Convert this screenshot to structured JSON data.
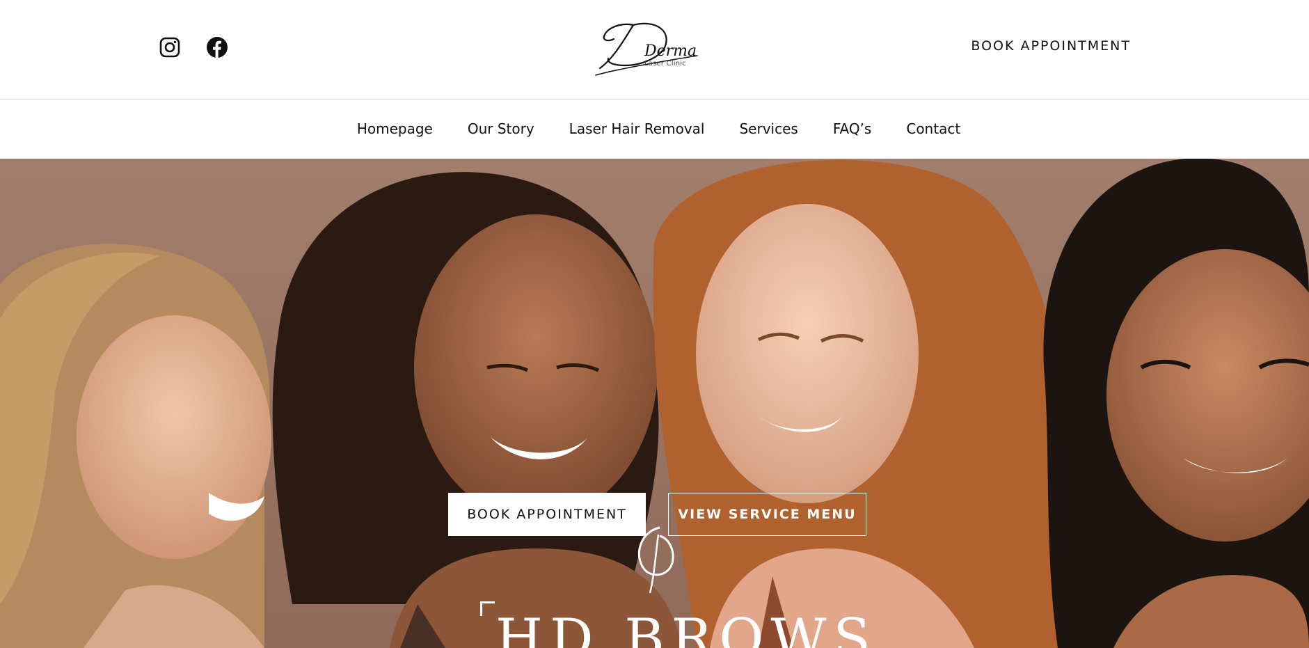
{
  "header": {
    "social": [
      {
        "icon": "instagram-icon"
      },
      {
        "icon": "facebook-icon"
      }
    ],
    "logo": {
      "script_text": "Derma",
      "sub_text": "Laser Clinic"
    },
    "book_label": "BOOK APPOINTMENT"
  },
  "nav": {
    "items": [
      {
        "label": "Homepage"
      },
      {
        "label": "Our Story"
      },
      {
        "label": "Laser Hair Removal"
      },
      {
        "label": "Services"
      },
      {
        "label": "FAQ’s"
      },
      {
        "label": "Contact"
      }
    ]
  },
  "hero": {
    "primary_button": "BOOK APPOINTMENT",
    "secondary_button": "VIEW SERVICE MENU",
    "brand_text": "HD BROWS"
  },
  "colors": {
    "hero_bg": "#a68270",
    "text": "#111111",
    "white": "#ffffff"
  }
}
